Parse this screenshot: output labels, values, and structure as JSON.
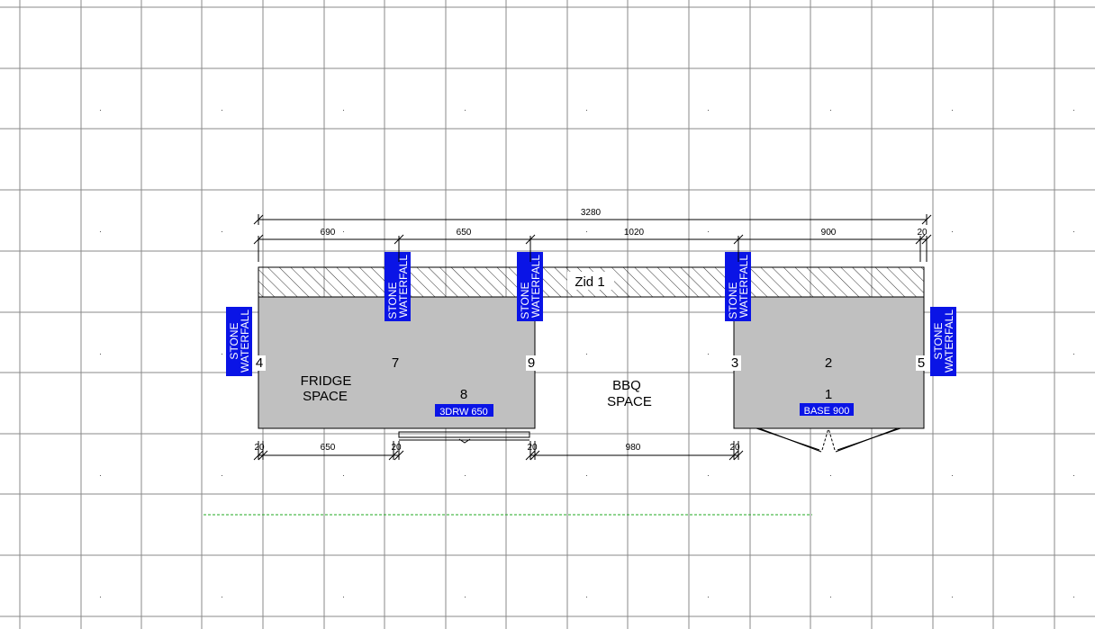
{
  "plan": {
    "wall_label": "Zid 1",
    "dims_top": {
      "overall": "3280",
      "seg1": "690",
      "seg2": "650",
      "seg3": "1020",
      "seg4": "900",
      "seg5": "20"
    },
    "dims_bottom": {
      "a": "20",
      "b": "650",
      "c": "20",
      "d": "20",
      "e": "980",
      "f": "20"
    },
    "waterfall_label": [
      "STONE",
      "WATERFALL"
    ],
    "numbers": {
      "n1": "1",
      "n2": "2",
      "n3": "3",
      "n4": "4",
      "n5": "5",
      "n7": "7",
      "n8": "8",
      "n9": "9"
    },
    "fridge_space": [
      "FRIDGE",
      "SPACE"
    ],
    "bbq_space": [
      "BBQ",
      "SPACE"
    ],
    "tag_drawer": "3DRW 650",
    "tag_base": "BASE 900"
  },
  "colors": {
    "grid": "#8a8a8a",
    "cabinet": "#c0c0c0",
    "tag": "#0a14e6",
    "tag_text": "#ffffff",
    "guide": "#22aa22"
  }
}
